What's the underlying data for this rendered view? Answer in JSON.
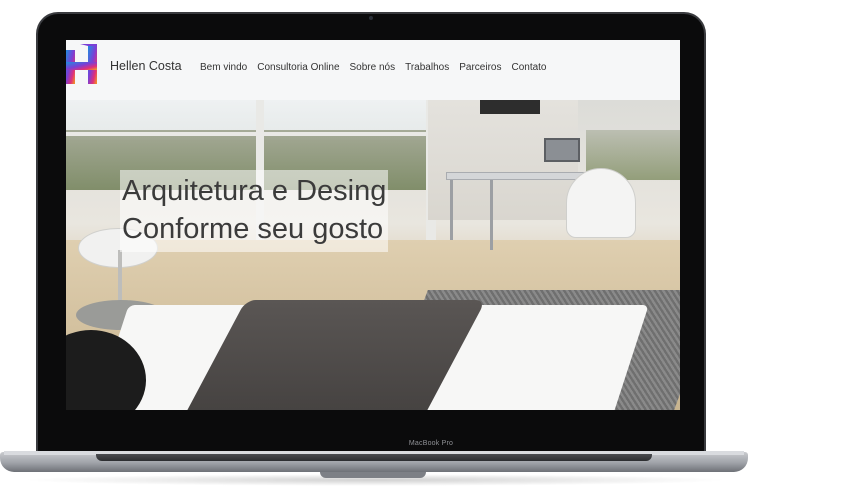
{
  "device": {
    "brand_label": "MacBook Pro"
  },
  "site": {
    "name": "Hellen Costa",
    "logo_colors": [
      "#1f8de0",
      "#e0307a",
      "#f4a11a",
      "#7a3fd6"
    ]
  },
  "nav": {
    "items": [
      "Bem vindo",
      "Consultoria Online",
      "Sobre nós",
      "Trabalhos",
      "Parceiros",
      "Contato"
    ]
  },
  "hero": {
    "line1": "Arquitetura e Desing",
    "line2": "Conforme seu gosto"
  }
}
